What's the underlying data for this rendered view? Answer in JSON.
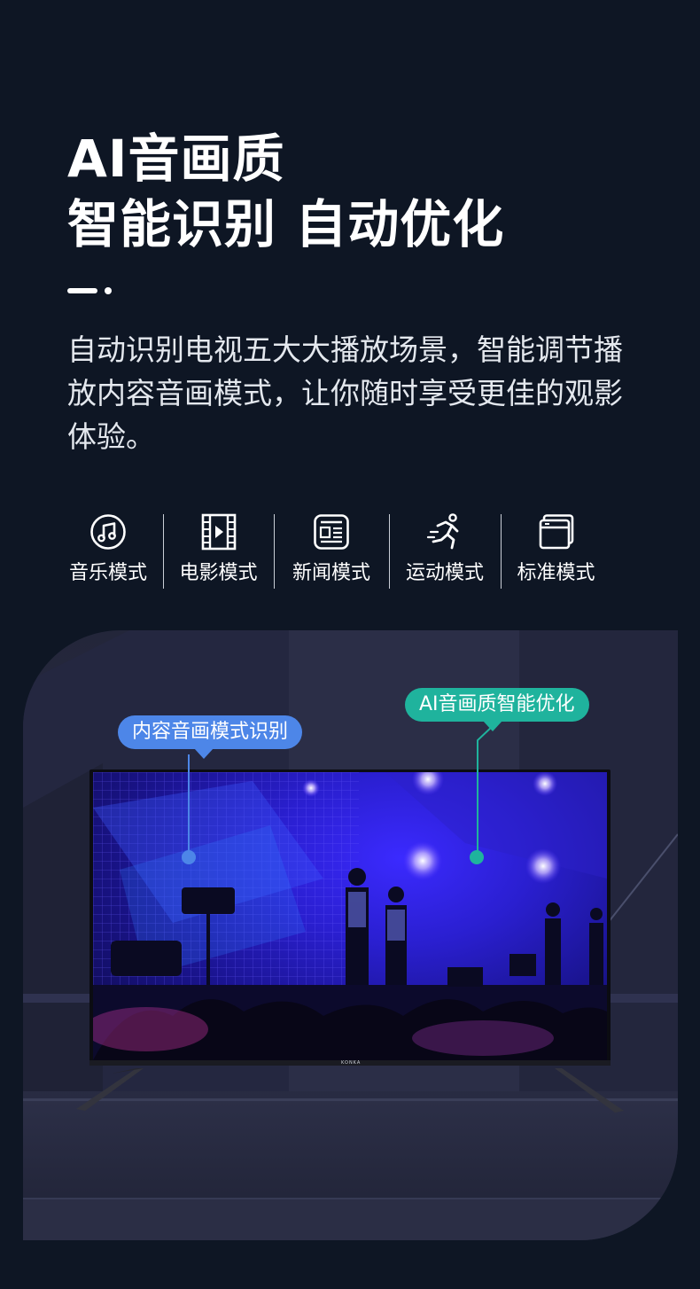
{
  "headline": {
    "line1": "AI音画质",
    "line2": "智能识别 自动优化"
  },
  "description": "自动识别电视五大大播放场景，智能调节播放内容音画模式，让你随时享受更佳的观影体验。",
  "modes": [
    {
      "label": "音乐模式",
      "icon": "music-note-icon"
    },
    {
      "label": "电影模式",
      "icon": "film-strip-icon"
    },
    {
      "label": "新闻模式",
      "icon": "newspaper-icon"
    },
    {
      "label": "运动模式",
      "icon": "running-person-icon"
    },
    {
      "label": "标准模式",
      "icon": "standard-screen-icon"
    }
  ],
  "scene": {
    "tv_brand": "KONKA",
    "callout_left": "内容音画模式识别",
    "callout_right": "AI音画质智能优化"
  },
  "colors": {
    "background": "#0e1624",
    "callout_blue": "#4d86e8",
    "callout_teal": "#1fb39d"
  }
}
